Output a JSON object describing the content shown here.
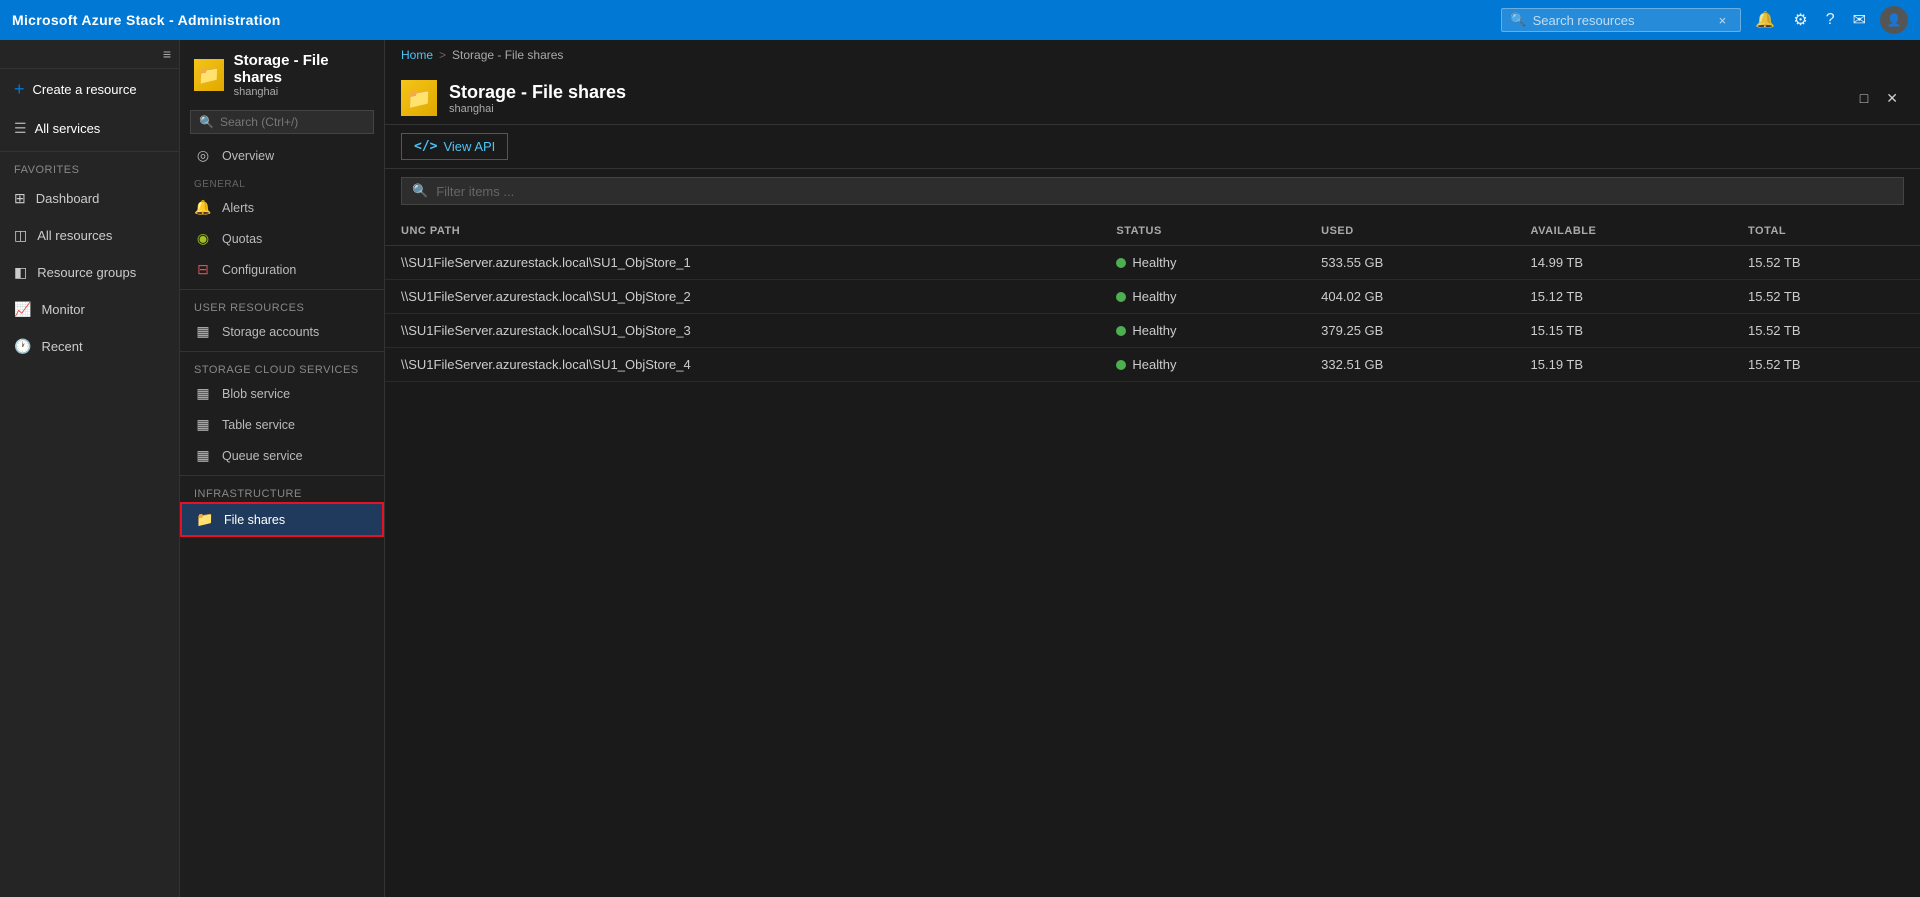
{
  "app": {
    "title": "Microsoft Azure Stack - Administration",
    "accent_color": "#0078d4"
  },
  "topbar": {
    "title": "Microsoft Azure Stack - Administration",
    "search_placeholder": "Search resources",
    "search_close": "×"
  },
  "sidebar": {
    "create_resource_label": "Create a resource",
    "all_services_label": "All services",
    "favorites_label": "FAVORITES",
    "items": [
      {
        "id": "dashboard",
        "label": "Dashboard",
        "icon": "⊞"
      },
      {
        "id": "all-resources",
        "label": "All resources",
        "icon": "◫"
      },
      {
        "id": "resource-groups",
        "label": "Resource groups",
        "icon": "◧"
      },
      {
        "id": "monitor",
        "label": "Monitor",
        "icon": "📈"
      },
      {
        "id": "recent",
        "label": "Recent",
        "icon": "🕐"
      }
    ]
  },
  "resource_nav": {
    "title": "Storage - File shares",
    "subtitle": "shanghai",
    "search_placeholder": "Search (Ctrl+/)",
    "sections": {
      "general_label": "GENERAL",
      "user_resources_label": "USER RESOURCES",
      "storage_cloud_services_label": "STORAGE CLOUD SERVICES",
      "infrastructure_label": "INFRASTRUCTURE"
    },
    "general_items": [
      {
        "id": "overview",
        "label": "Overview",
        "icon": "◎"
      }
    ],
    "general_sub_items": [
      {
        "id": "alerts",
        "label": "Alerts",
        "icon": "🔔"
      },
      {
        "id": "quotas",
        "label": "Quotas",
        "icon": "◉"
      },
      {
        "id": "configuration",
        "label": "Configuration",
        "icon": "⊟"
      }
    ],
    "user_resources_items": [
      {
        "id": "storage-accounts",
        "label": "Storage accounts",
        "icon": "▦"
      }
    ],
    "cloud_services_items": [
      {
        "id": "blob-service",
        "label": "Blob service",
        "icon": "▦"
      },
      {
        "id": "table-service",
        "label": "Table service",
        "icon": "▦"
      },
      {
        "id": "queue-service",
        "label": "Queue service",
        "icon": "▦"
      }
    ],
    "infrastructure_items": [
      {
        "id": "file-shares",
        "label": "File shares",
        "icon": "📁",
        "active": true
      }
    ]
  },
  "content": {
    "breadcrumb": {
      "home": "Home",
      "separator": ">",
      "current": "Storage - File shares"
    },
    "title": "Storage - File shares",
    "subtitle": "shanghai",
    "toolbar": {
      "view_api_label": "View API",
      "view_api_icon": "<>"
    },
    "filter_placeholder": "Filter items ...",
    "table": {
      "columns": [
        {
          "id": "unc_path",
          "label": "UNC PATH"
        },
        {
          "id": "status",
          "label": "STATUS"
        },
        {
          "id": "used",
          "label": "USED"
        },
        {
          "id": "available",
          "label": "AVAILABLE"
        },
        {
          "id": "total",
          "label": "TOTAL"
        }
      ],
      "rows": [
        {
          "unc_path": "\\\\SU1FileServer.azurestack.local\\SU1_ObjStore_1",
          "status": "Healthy",
          "used": "533.55 GB",
          "available": "14.99 TB",
          "total": "15.52 TB"
        },
        {
          "unc_path": "\\\\SU1FileServer.azurestack.local\\SU1_ObjStore_2",
          "status": "Healthy",
          "used": "404.02 GB",
          "available": "15.12 TB",
          "total": "15.52 TB"
        },
        {
          "unc_path": "\\\\SU1FileServer.azurestack.local\\SU1_ObjStore_3",
          "status": "Healthy",
          "used": "379.25 GB",
          "available": "15.15 TB",
          "total": "15.52 TB"
        },
        {
          "unc_path": "\\\\SU1FileServer.azurestack.local\\SU1_ObjStore_4",
          "status": "Healthy",
          "used": "332.51 GB",
          "available": "15.19 TB",
          "total": "15.52 TB"
        }
      ]
    }
  },
  "window_controls": {
    "minimize": "—",
    "maximize": "□",
    "close": "✕"
  }
}
